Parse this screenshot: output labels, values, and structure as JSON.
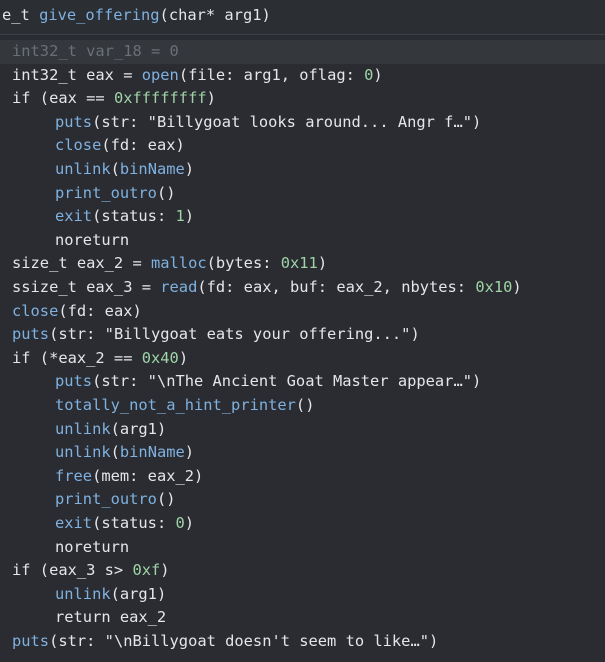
{
  "header": {
    "tokens": [
      {
        "t": "e_t ",
        "c": "plain"
      },
      {
        "t": "give_offering",
        "c": "func"
      },
      {
        "t": "(char* arg1)",
        "c": "plain"
      }
    ]
  },
  "lines": [
    {
      "indent": 1,
      "dim": true,
      "tokens": [
        {
          "t": "int32_t var_18 = 0",
          "c": "dim"
        }
      ]
    },
    {
      "indent": 1,
      "tokens": [
        {
          "t": "int32_t eax = ",
          "c": "plain"
        },
        {
          "t": "open",
          "c": "func"
        },
        {
          "t": "(file: arg1, oflag: ",
          "c": "plain"
        },
        {
          "t": "0",
          "c": "num"
        },
        {
          "t": ")",
          "c": "plain"
        }
      ]
    },
    {
      "indent": 1,
      "tokens": [
        {
          "t": "if (eax == ",
          "c": "plain"
        },
        {
          "t": "0xffffffff",
          "c": "num"
        },
        {
          "t": ")",
          "c": "plain"
        }
      ]
    },
    {
      "indent": 2,
      "tokens": [
        {
          "t": "puts",
          "c": "func"
        },
        {
          "t": "(str: \"Billygoat looks around... Angr f…\")",
          "c": "plain"
        }
      ]
    },
    {
      "indent": 2,
      "tokens": [
        {
          "t": "close",
          "c": "func"
        },
        {
          "t": "(fd: eax)",
          "c": "plain"
        }
      ]
    },
    {
      "indent": 2,
      "tokens": [
        {
          "t": "unlink",
          "c": "func"
        },
        {
          "t": "(",
          "c": "plain"
        },
        {
          "t": "binName",
          "c": "func"
        },
        {
          "t": ")",
          "c": "plain"
        }
      ]
    },
    {
      "indent": 2,
      "tokens": [
        {
          "t": "print_outro",
          "c": "func"
        },
        {
          "t": "()",
          "c": "plain"
        }
      ]
    },
    {
      "indent": 2,
      "tokens": [
        {
          "t": "exit",
          "c": "func"
        },
        {
          "t": "(status: ",
          "c": "plain"
        },
        {
          "t": "1",
          "c": "num"
        },
        {
          "t": ")",
          "c": "plain"
        }
      ]
    },
    {
      "indent": 2,
      "tokens": [
        {
          "t": "noreturn",
          "c": "plain"
        }
      ]
    },
    {
      "indent": 1,
      "tokens": [
        {
          "t": "size_t eax_2 = ",
          "c": "plain"
        },
        {
          "t": "malloc",
          "c": "func"
        },
        {
          "t": "(bytes: ",
          "c": "plain"
        },
        {
          "t": "0x11",
          "c": "num"
        },
        {
          "t": ")",
          "c": "plain"
        }
      ]
    },
    {
      "indent": 1,
      "tokens": [
        {
          "t": "ssize_t eax_3 = ",
          "c": "plain"
        },
        {
          "t": "read",
          "c": "func"
        },
        {
          "t": "(fd: eax, buf: eax_2, nbytes: ",
          "c": "plain"
        },
        {
          "t": "0x10",
          "c": "num"
        },
        {
          "t": ")",
          "c": "plain"
        }
      ]
    },
    {
      "indent": 1,
      "tokens": [
        {
          "t": "close",
          "c": "func"
        },
        {
          "t": "(fd: eax)",
          "c": "plain"
        }
      ]
    },
    {
      "indent": 1,
      "tokens": [
        {
          "t": "puts",
          "c": "func"
        },
        {
          "t": "(str: \"Billygoat eats your offering...\")",
          "c": "plain"
        }
      ]
    },
    {
      "indent": 1,
      "tokens": [
        {
          "t": "if (*eax_2 == ",
          "c": "plain"
        },
        {
          "t": "0x40",
          "c": "num"
        },
        {
          "t": ")",
          "c": "plain"
        }
      ]
    },
    {
      "indent": 2,
      "tokens": [
        {
          "t": "puts",
          "c": "func"
        },
        {
          "t": "(str: \"\\nThe Ancient Goat Master appear…\")",
          "c": "plain"
        }
      ]
    },
    {
      "indent": 2,
      "tokens": [
        {
          "t": "totally_not_a_hint_printer",
          "c": "func"
        },
        {
          "t": "()",
          "c": "plain"
        }
      ]
    },
    {
      "indent": 2,
      "tokens": [
        {
          "t": "unlink",
          "c": "func"
        },
        {
          "t": "(arg1)",
          "c": "plain"
        }
      ]
    },
    {
      "indent": 2,
      "tokens": [
        {
          "t": "unlink",
          "c": "func"
        },
        {
          "t": "(",
          "c": "plain"
        },
        {
          "t": "binName",
          "c": "func"
        },
        {
          "t": ")",
          "c": "plain"
        }
      ]
    },
    {
      "indent": 2,
      "tokens": [
        {
          "t": "free",
          "c": "func"
        },
        {
          "t": "(mem: eax_2)",
          "c": "plain"
        }
      ]
    },
    {
      "indent": 2,
      "tokens": [
        {
          "t": "print_outro",
          "c": "func"
        },
        {
          "t": "()",
          "c": "plain"
        }
      ]
    },
    {
      "indent": 2,
      "tokens": [
        {
          "t": "exit",
          "c": "func"
        },
        {
          "t": "(status: ",
          "c": "plain"
        },
        {
          "t": "0",
          "c": "num"
        },
        {
          "t": ")",
          "c": "plain"
        }
      ]
    },
    {
      "indent": 2,
      "tokens": [
        {
          "t": "noreturn",
          "c": "plain"
        }
      ]
    },
    {
      "indent": 1,
      "tokens": [
        {
          "t": "if (eax_3 s> ",
          "c": "plain"
        },
        {
          "t": "0xf",
          "c": "num"
        },
        {
          "t": ")",
          "c": "plain"
        }
      ]
    },
    {
      "indent": 2,
      "tokens": [
        {
          "t": "unlink",
          "c": "func"
        },
        {
          "t": "(arg1)",
          "c": "plain"
        }
      ]
    },
    {
      "indent": 2,
      "tokens": [
        {
          "t": "return eax_2",
          "c": "plain"
        }
      ]
    },
    {
      "indent": 1,
      "tokens": [
        {
          "t": "puts",
          "c": "func"
        },
        {
          "t": "(str: \"\\nBillygoat doesn't seem to like…\")",
          "c": "plain"
        }
      ]
    }
  ]
}
